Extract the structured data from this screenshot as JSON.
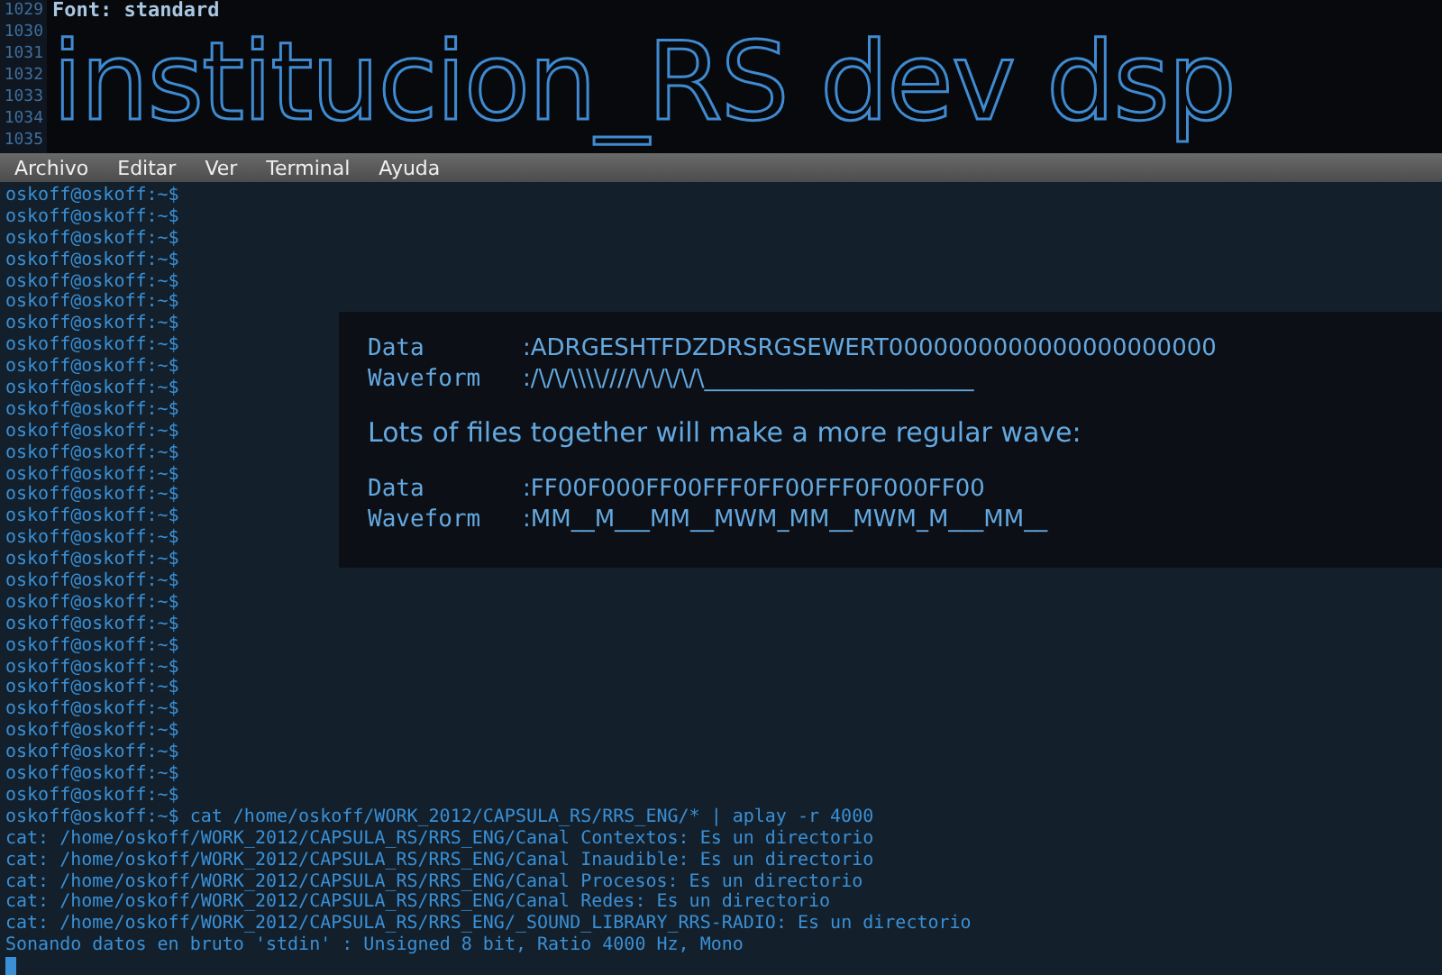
{
  "editor": {
    "line_numbers": [
      "1029",
      "1030",
      "1031",
      "1032",
      "1033",
      "1034",
      "1035"
    ],
    "header_line": "Font: standard",
    "banner_text": "institucion_RS dev dsp"
  },
  "menu_bar": {
    "items": [
      "Archivo",
      "Editar",
      "Ver",
      "Terminal",
      "Ayuda"
    ]
  },
  "terminal": {
    "lines": [
      {
        "kind": "prompt",
        "prompt": "oskoff@oskoff:~$"
      },
      {
        "kind": "prompt",
        "prompt": "oskoff@oskoff:~$"
      },
      {
        "kind": "prompt",
        "prompt": "oskoff@oskoff:~$"
      },
      {
        "kind": "prompt",
        "prompt": "oskoff@oskoff:~$"
      },
      {
        "kind": "prompt",
        "prompt": "oskoff@oskoff:~$"
      },
      {
        "kind": "prompt",
        "prompt": "oskoff@oskoff:~$"
      },
      {
        "kind": "prompt",
        "prompt": "oskoff@oskoff:~$"
      },
      {
        "kind": "prompt",
        "prompt": "oskoff@oskoff:~$"
      },
      {
        "kind": "prompt",
        "prompt": "oskoff@oskoff:~$"
      },
      {
        "kind": "prompt",
        "prompt": "oskoff@oskoff:~$"
      },
      {
        "kind": "prompt",
        "prompt": "oskoff@oskoff:~$"
      },
      {
        "kind": "prompt",
        "prompt": "oskoff@oskoff:~$"
      },
      {
        "kind": "prompt",
        "prompt": "oskoff@oskoff:~$"
      },
      {
        "kind": "prompt",
        "prompt": "oskoff@oskoff:~$"
      },
      {
        "kind": "prompt",
        "prompt": "oskoff@oskoff:~$"
      },
      {
        "kind": "prompt",
        "prompt": "oskoff@oskoff:~$"
      },
      {
        "kind": "prompt",
        "prompt": "oskoff@oskoff:~$"
      },
      {
        "kind": "prompt",
        "prompt": "oskoff@oskoff:~$"
      },
      {
        "kind": "prompt",
        "prompt": "oskoff@oskoff:~$"
      },
      {
        "kind": "prompt",
        "prompt": "oskoff@oskoff:~$"
      },
      {
        "kind": "prompt",
        "prompt": "oskoff@oskoff:~$"
      },
      {
        "kind": "prompt",
        "prompt": "oskoff@oskoff:~$"
      },
      {
        "kind": "prompt",
        "prompt": "oskoff@oskoff:~$"
      },
      {
        "kind": "prompt",
        "prompt": "oskoff@oskoff:~$"
      },
      {
        "kind": "prompt",
        "prompt": "oskoff@oskoff:~$"
      },
      {
        "kind": "prompt",
        "prompt": "oskoff@oskoff:~$"
      },
      {
        "kind": "prompt",
        "prompt": "oskoff@oskoff:~$"
      },
      {
        "kind": "prompt",
        "prompt": "oskoff@oskoff:~$"
      },
      {
        "kind": "prompt",
        "prompt": "oskoff@oskoff:~$"
      },
      {
        "kind": "prompt",
        "prompt": "oskoff@oskoff:~$",
        "command": "cat /home/oskoff/WORK_2012/CAPSULA_RS/RRS_ENG/* | aplay -r 4000"
      },
      {
        "kind": "output",
        "text": "cat: /home/oskoff/WORK_2012/CAPSULA_RS/RRS_ENG/Canal Contextos: Es un directorio"
      },
      {
        "kind": "output",
        "text": "cat: /home/oskoff/WORK_2012/CAPSULA_RS/RRS_ENG/Canal Inaudible: Es un directorio"
      },
      {
        "kind": "output",
        "text": "cat: /home/oskoff/WORK_2012/CAPSULA_RS/RRS_ENG/Canal Procesos: Es un directorio"
      },
      {
        "kind": "output",
        "text": "cat: /home/oskoff/WORK_2012/CAPSULA_RS/RRS_ENG/Canal Redes: Es un directorio"
      },
      {
        "kind": "output",
        "text": "cat: /home/oskoff/WORK_2012/CAPSULA_RS/RRS_ENG/_SOUND_LIBRARY_RRS-RADIO: Es un directorio"
      },
      {
        "kind": "output",
        "text": "Sonando datos en bruto 'stdin' : Unsigned 8 bit, Ratio 4000 Hz, Mono"
      },
      {
        "kind": "cursor"
      }
    ]
  },
  "overlay": {
    "top_rows": [
      {
        "label": "Data",
        "value": ":ADRGESHTFDZDRSRGSEWERT0000000000000000000000"
      },
      {
        "label": "Waveform",
        "value": ":/\\/\\/\\\\\\\\////\\/\\/\\/\\/\\_______________________"
      }
    ],
    "caption": "Lots of files together will make a more regular wave:",
    "bottom_rows": [
      {
        "label": "Data",
        "value": ":FF00F000FF00FFF0FF00FFF0F000FF00"
      },
      {
        "label": "Waveform",
        "value": ":MM__M___MM__MWM_MM__MWM_M___MM__"
      }
    ]
  }
}
